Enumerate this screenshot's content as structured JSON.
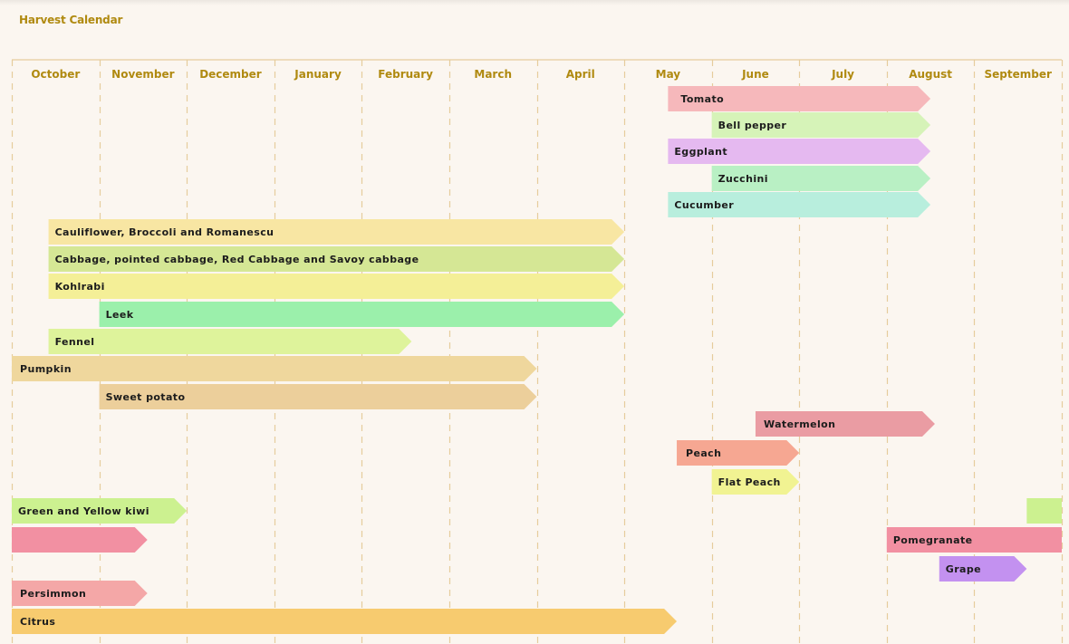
{
  "app": {
    "title": "Harvest Calendar"
  },
  "chart_data": {
    "type": "gantt",
    "title": "Harvest Calendar",
    "months": [
      "October",
      "November",
      "December",
      "January",
      "February",
      "March",
      "April",
      "May",
      "June",
      "July",
      "August",
      "September"
    ],
    "units": "months from start of October (0 = Oct 1, 12 = end of September)",
    "colors": {
      "header_text": "#b08a10",
      "gridline": "#e6cc9c",
      "background": "#fbf6f0",
      "label_text": "#1c1c1c"
    },
    "items": [
      {
        "name": "Tomato",
        "color": "#f6b8bb",
        "segments": [
          [
            7.5,
            10.5
          ]
        ]
      },
      {
        "name": "Bell pepper",
        "color": "#d6f3b8",
        "segments": [
          [
            8.0,
            10.5
          ]
        ]
      },
      {
        "name": "Eggplant",
        "color": "#e5b9f0",
        "segments": [
          [
            7.5,
            10.5
          ]
        ]
      },
      {
        "name": "Zucchini",
        "color": "#b9f0c4",
        "segments": [
          [
            8.0,
            10.5
          ]
        ]
      },
      {
        "name": "Cucumber",
        "color": "#b8eedd",
        "segments": [
          [
            7.5,
            10.5
          ]
        ]
      },
      {
        "name": "Cauliflower, Broccoli and Romanescu",
        "color": "#f8e6a3",
        "segments": [
          [
            0.42,
            7.0
          ]
        ]
      },
      {
        "name": "Cabbage, pointed cabbage, Red Cabbage and Savoy cabbage",
        "color": "#d5e795",
        "segments": [
          [
            0.42,
            7.0
          ]
        ]
      },
      {
        "name": "Kohlrabi",
        "color": "#f4ef97",
        "segments": [
          [
            0.42,
            7.0
          ]
        ]
      },
      {
        "name": "Leek",
        "color": "#9bf0ab",
        "segments": [
          [
            1.0,
            7.0
          ]
        ]
      },
      {
        "name": "Fennel",
        "color": "#def39b",
        "segments": [
          [
            0.42,
            4.57
          ]
        ]
      },
      {
        "name": "Pumpkin",
        "color": "#efd79d",
        "segments": [
          [
            0.0,
            6.0
          ]
        ]
      },
      {
        "name": "Sweet potato",
        "color": "#eccf9b",
        "segments": [
          [
            1.0,
            6.0
          ]
        ]
      },
      {
        "name": "Watermelon",
        "color": "#ea9ca3",
        "segments": [
          [
            8.5,
            10.55
          ]
        ]
      },
      {
        "name": "Peach",
        "color": "#f6a792",
        "segments": [
          [
            7.6,
            9.0
          ]
        ]
      },
      {
        "name": "Flat Peach",
        "color": "#f1f392",
        "segments": [
          [
            8.0,
            9.0
          ]
        ]
      },
      {
        "name": "Green and Yellow kiwi",
        "color": "#ccf190",
        "segments": [
          [
            0.0,
            2.0
          ],
          [
            11.6,
            12.0
          ]
        ]
      },
      {
        "name": "Pomegranate",
        "color": "#f290a2",
        "segments": [
          [
            0.0,
            1.55
          ],
          [
            10.0,
            12.0
          ]
        ]
      },
      {
        "name": "Grape",
        "color": "#c391f0",
        "segments": [
          [
            10.6,
            11.6
          ]
        ]
      },
      {
        "name": "Persimmon",
        "color": "#f4a7a7",
        "segments": [
          [
            0.0,
            1.55
          ]
        ]
      },
      {
        "name": "Citrus",
        "color": "#f7cb6f",
        "segments": [
          [
            0.0,
            7.6
          ]
        ]
      }
    ]
  }
}
